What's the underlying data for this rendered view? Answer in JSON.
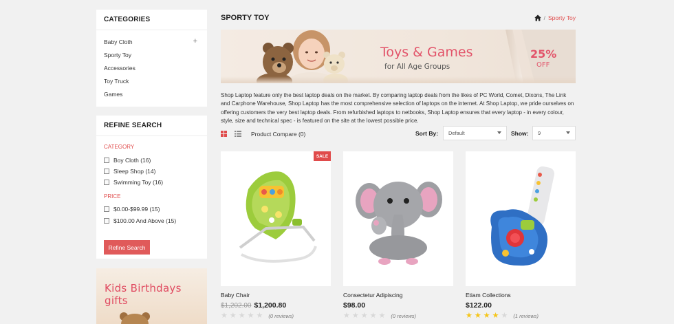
{
  "sidebar": {
    "categories_title": "CATEGORIES",
    "categories": [
      "Baby Cloth",
      "Sporty Toy",
      "Accessories",
      "Toy Truck",
      "Games"
    ],
    "expand_symbol": "+",
    "refine_title": "REFINE SEARCH",
    "category_heading": "CATEGORY",
    "category_filters": [
      "Boy Cloth (16)",
      "Sleep Shop (14)",
      "Swimming Toy (16)"
    ],
    "price_heading": "PRICE",
    "price_filters": [
      "$0.00-$99.99 (15)",
      "$100.00 And Above (15)"
    ],
    "refine_button": "Refine Search",
    "promo_text": "Kids Birthdays gifts"
  },
  "page": {
    "title": "SPORTY TOY",
    "breadcrumb_sep": "/",
    "breadcrumb_current": "Sporty Toy"
  },
  "hero": {
    "headline": "Toys & Games",
    "subline": "for All Age Groups",
    "discount": "25%",
    "discount_suffix": "OFF"
  },
  "description": "Shop Laptop feature only the best laptop deals on the market. By comparing laptop deals from the likes of PC World, Comet, Dixons, The Link and Carphone Warehouse, Shop Laptop has the most comprehensive selection of laptops on the internet. At Shop Laptop, we pride ourselves on offering customers the very best laptop deals. From refurbished laptops to netbooks, Shop Laptop ensures that every laptop - in every colour, style, size and technical spec - is featured on the site at the lowest possible price.",
  "toolbar": {
    "compare": "Product Compare (0)",
    "sort_label": "Sort By:",
    "sort_value": "Default",
    "show_label": "Show:",
    "show_value": "9"
  },
  "products": [
    {
      "name": "Baby Chair",
      "old_price": "$1,202.00",
      "price": "$1,200.80",
      "badge": "SALE",
      "rating": 0,
      "reviews": "(0 reviews)"
    },
    {
      "name": "Consectetur Adipiscing",
      "old_price": "",
      "price": "$98.00",
      "badge": "",
      "rating": 0,
      "reviews": "(0 reviews)"
    },
    {
      "name": "Etiam Collections",
      "old_price": "",
      "price": "$122.00",
      "badge": "",
      "rating": 4,
      "reviews": "(1 reviews)"
    }
  ],
  "colors": {
    "accent": "#e04b4b",
    "star_on": "#f5c518",
    "star_off": "#d8d8d8"
  }
}
